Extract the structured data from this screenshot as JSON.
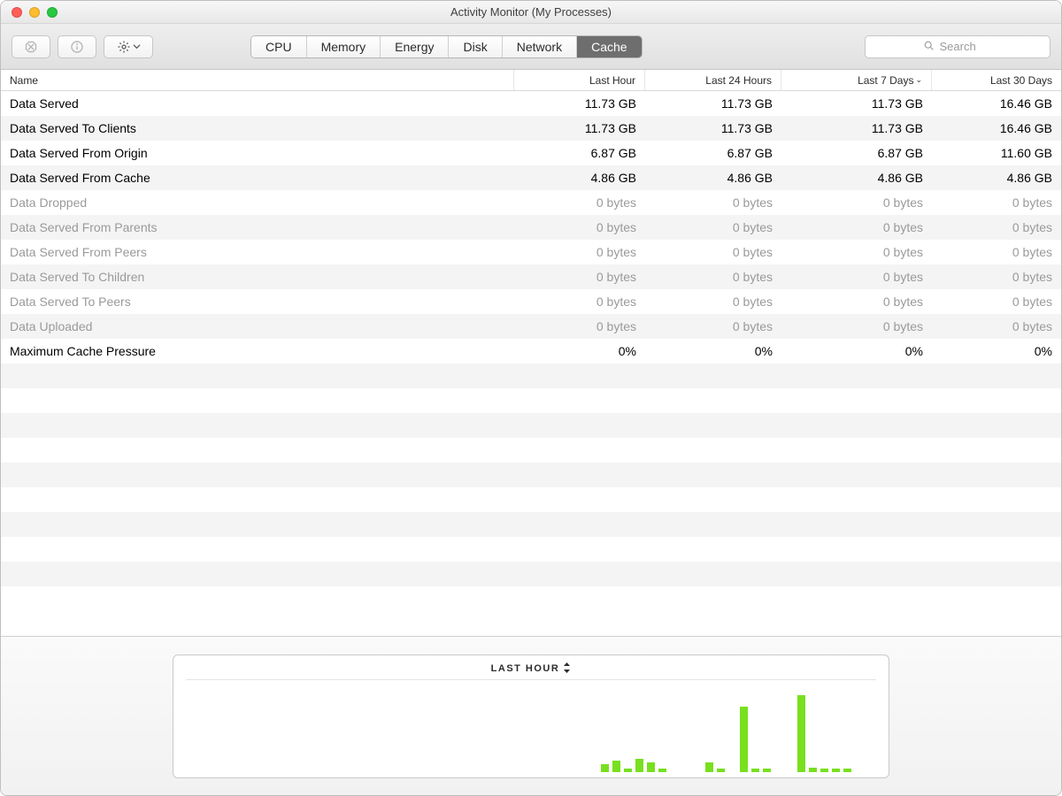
{
  "window": {
    "title": "Activity Monitor (My Processes)"
  },
  "traffic": {
    "close": "close",
    "minimize": "minimize",
    "zoom": "zoom"
  },
  "toolbar": {
    "stop_icon": "stop-process-icon",
    "info_icon": "info-icon",
    "gear_icon": "gear-icon",
    "tabs": [
      {
        "label": "CPU",
        "active": false
      },
      {
        "label": "Memory",
        "active": false
      },
      {
        "label": "Energy",
        "active": false
      },
      {
        "label": "Disk",
        "active": false
      },
      {
        "label": "Network",
        "active": false
      },
      {
        "label": "Cache",
        "active": true
      }
    ],
    "search": {
      "placeholder": "Search",
      "value": ""
    }
  },
  "columns": {
    "name": "Name",
    "last_hour": "Last Hour",
    "last_24h": "Last 24 Hours",
    "last_7d": "Last 7 Days",
    "last_30d": "Last 30 Days",
    "sorted_column": "last_7d",
    "sort_indicator": "⌄"
  },
  "rows": [
    {
      "dim": false,
      "name": "Data Served",
      "a": "11.73 GB",
      "b": "11.73 GB",
      "c": "11.73 GB",
      "d": "16.46 GB"
    },
    {
      "dim": false,
      "name": "Data Served To Clients",
      "a": "11.73 GB",
      "b": "11.73 GB",
      "c": "11.73 GB",
      "d": "16.46 GB"
    },
    {
      "dim": false,
      "name": "Data Served From Origin",
      "a": "6.87 GB",
      "b": "6.87 GB",
      "c": "6.87 GB",
      "d": "11.60 GB"
    },
    {
      "dim": false,
      "name": "Data Served From Cache",
      "a": "4.86 GB",
      "b": "4.86 GB",
      "c": "4.86 GB",
      "d": "4.86 GB"
    },
    {
      "dim": true,
      "name": "Data Dropped",
      "a": "0 bytes",
      "b": "0 bytes",
      "c": "0 bytes",
      "d": "0 bytes"
    },
    {
      "dim": true,
      "name": "Data Served From Parents",
      "a": "0 bytes",
      "b": "0 bytes",
      "c": "0 bytes",
      "d": "0 bytes"
    },
    {
      "dim": true,
      "name": "Data Served From Peers",
      "a": "0 bytes",
      "b": "0 bytes",
      "c": "0 bytes",
      "d": "0 bytes"
    },
    {
      "dim": true,
      "name": "Data Served To Children",
      "a": "0 bytes",
      "b": "0 bytes",
      "c": "0 bytes",
      "d": "0 bytes"
    },
    {
      "dim": true,
      "name": "Data Served To Peers",
      "a": "0 bytes",
      "b": "0 bytes",
      "c": "0 bytes",
      "d": "0 bytes"
    },
    {
      "dim": true,
      "name": "Data Uploaded",
      "a": "0 bytes",
      "b": "0 bytes",
      "c": "0 bytes",
      "d": "0 bytes"
    },
    {
      "dim": false,
      "name": "Maximum Cache Pressure",
      "a": "0%",
      "b": "0%",
      "c": "0%",
      "d": "0%"
    }
  ],
  "empty_row_count": 10,
  "chart": {
    "title": "LAST HOUR",
    "updown_icon": "up-down-arrows-icon"
  },
  "chart_data": {
    "type": "bar",
    "title": "LAST HOUR",
    "xlabel": "",
    "ylabel": "",
    "values_relative_pct_height": [
      0,
      0,
      0,
      0,
      0,
      0,
      0,
      0,
      0,
      0,
      0,
      0,
      0,
      0,
      0,
      0,
      0,
      0,
      0,
      0,
      0,
      0,
      0,
      0,
      0,
      0,
      0,
      0,
      0,
      0,
      0,
      0,
      0,
      0,
      0,
      0,
      8,
      12,
      3,
      14,
      10,
      3,
      0,
      0,
      0,
      10,
      3,
      0,
      72,
      3,
      3,
      0,
      0,
      85,
      4,
      3,
      3,
      3,
      0,
      0
    ],
    "note": "Axis is unlabeled; values are relative bar heights as percentage of panel height. Bar color hex #78e01e."
  },
  "colors": {
    "bar_green": "#78e01e",
    "tab_active_bg": "#6e6e6e"
  }
}
